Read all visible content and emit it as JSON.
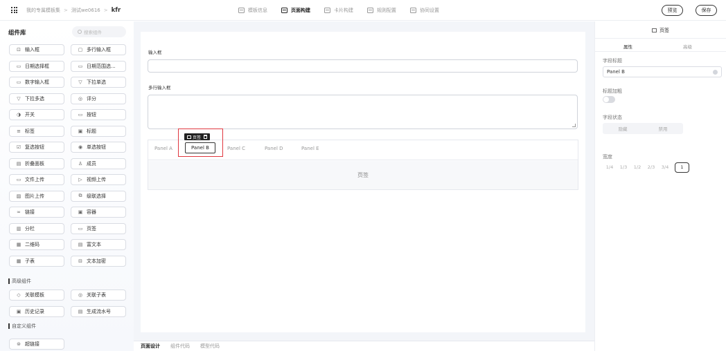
{
  "header": {
    "breadcrumbs": [
      "我的专属模板集",
      "测试we0616",
      "kfr"
    ],
    "tabs": [
      {
        "label": "模板信息",
        "icon": "template-info-icon",
        "active": false
      },
      {
        "label": "页面构建",
        "icon": "page-build-icon",
        "active": true
      },
      {
        "label": "卡片构建",
        "icon": "card-build-icon",
        "active": false
      },
      {
        "label": "规则配置",
        "icon": "rule-config-icon",
        "active": false
      },
      {
        "label": "协同设置",
        "icon": "collab-settings-icon",
        "active": false
      }
    ],
    "preview_label": "预览",
    "save_label": "保存"
  },
  "sidebar": {
    "title": "组件库",
    "search_placeholder": "搜索组件",
    "components": [
      {
        "label": "输入框",
        "icon": "⊡"
      },
      {
        "label": "多行输入框",
        "icon": "▢"
      },
      {
        "label": "日期选择框",
        "icon": "▭"
      },
      {
        "label": "日期范围选...",
        "icon": "▭"
      },
      {
        "label": "数字输入框",
        "icon": "▭"
      },
      {
        "label": "下拉单选",
        "icon": "▽"
      },
      {
        "label": "下拉多选",
        "icon": "▽"
      },
      {
        "label": "评分",
        "icon": "◎"
      },
      {
        "label": "开关",
        "icon": "◑"
      },
      {
        "label": "按钮",
        "icon": "▭"
      },
      {
        "label": "标签",
        "icon": "≡"
      },
      {
        "label": "标题",
        "icon": "▣"
      },
      {
        "label": "复选按钮",
        "icon": "☑"
      },
      {
        "label": "单选按钮",
        "icon": "◉"
      },
      {
        "label": "折叠面板",
        "icon": "▤"
      },
      {
        "label": "成员",
        "icon": "♙"
      },
      {
        "label": "文件上传",
        "icon": "▭"
      },
      {
        "label": "视频上传",
        "icon": "▷"
      },
      {
        "label": "图片上传",
        "icon": "▨"
      },
      {
        "label": "级联选择",
        "icon": "⧉"
      },
      {
        "label": "链接",
        "icon": "∞"
      },
      {
        "label": "容器",
        "icon": "▣"
      },
      {
        "label": "分栏",
        "icon": "▥"
      },
      {
        "label": "页签",
        "icon": "▭"
      },
      {
        "label": "二维码",
        "icon": "▦"
      },
      {
        "label": "富文本",
        "icon": "▤"
      },
      {
        "label": "子表",
        "icon": "▦"
      },
      {
        "label": "文本加密",
        "icon": "⊟"
      }
    ],
    "advanced_title": "高级组件",
    "advanced_components": [
      {
        "label": "关联模板",
        "icon": "◇"
      },
      {
        "label": "关联子表",
        "icon": "◎"
      },
      {
        "label": "历史记录",
        "icon": "▣"
      },
      {
        "label": "生成流水号",
        "icon": "▤"
      }
    ],
    "custom_title": "自定义组件",
    "custom_components": [
      {
        "label": "超链接",
        "icon": "⊜"
      }
    ]
  },
  "canvas": {
    "input_label": "输入框",
    "textarea_label": "多行输入框",
    "tabs": [
      "Panel A",
      "Panel B",
      "Panel C",
      "Panel D",
      "Panel E"
    ],
    "active_tab": "Panel B",
    "tab_content": "页签",
    "selection_toolbar_label": "页签"
  },
  "bottom_tabs": [
    {
      "label": "页面设计",
      "active": true
    },
    {
      "label": "组件代码",
      "active": false
    },
    {
      "label": "模型代码",
      "active": false
    }
  ],
  "right_panel": {
    "title": "页签",
    "tabs": [
      {
        "label": "属性",
        "active": true
      },
      {
        "label": "高级",
        "active": false
      }
    ],
    "field_title_label": "字段标题",
    "field_title_value": "Panel B",
    "bold_title_label": "标题加粗",
    "bold_title_on": false,
    "field_state_label": "字段状态",
    "field_state_options": [
      "隐藏",
      "禁用"
    ],
    "width_label": "宽度",
    "width_options": [
      "1/4",
      "1/3",
      "1/2",
      "2/3",
      "3/4",
      "1"
    ],
    "width_selected": "1"
  },
  "colors": {
    "selection_border": "#e0373f",
    "canvas_background": "#f3f5f9"
  }
}
